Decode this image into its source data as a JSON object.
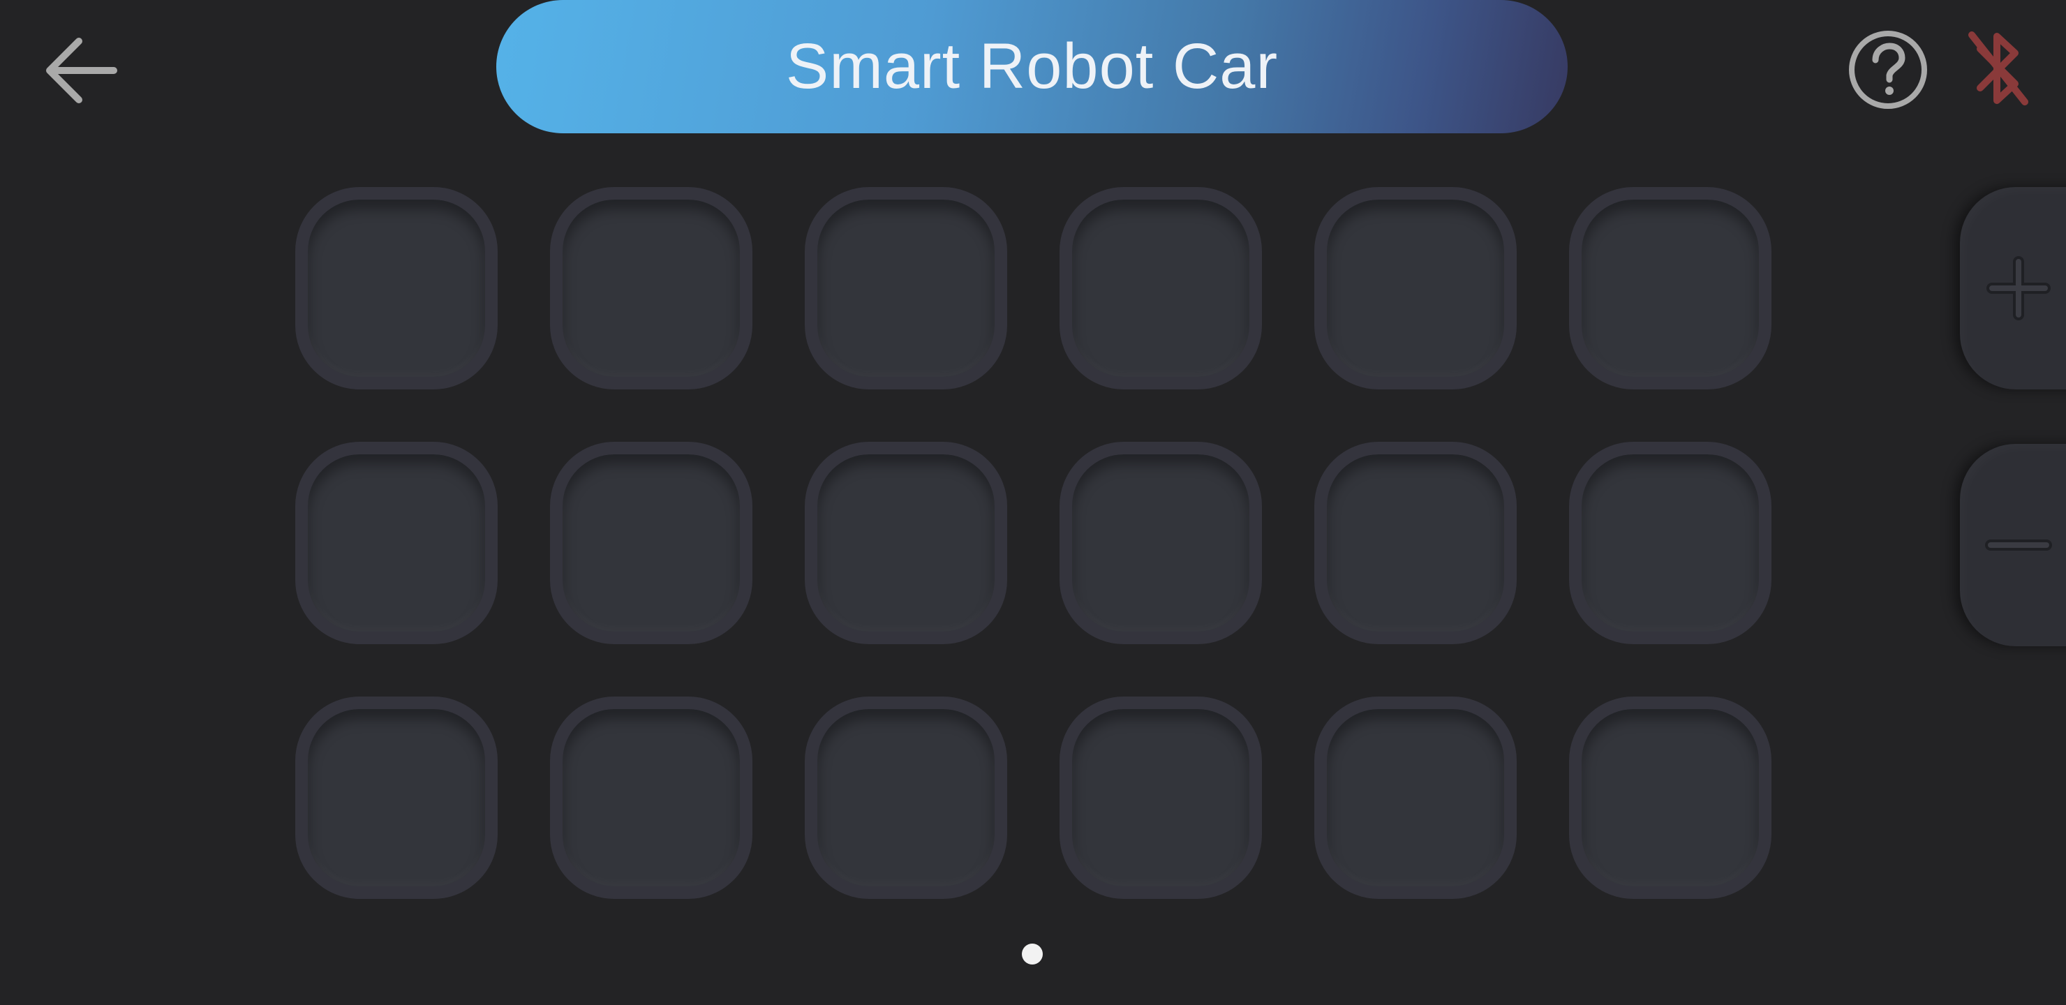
{
  "header": {
    "title": "Smart Robot Car",
    "icons": {
      "back": "back-arrow-icon",
      "help": "help-icon",
      "bluetooth": "bluetooth-disconnected-icon"
    }
  },
  "grid": {
    "rows": 3,
    "columns": 6,
    "slots": [
      {
        "row": 1,
        "col": 1
      },
      {
        "row": 1,
        "col": 2
      },
      {
        "row": 1,
        "col": 3
      },
      {
        "row": 1,
        "col": 4
      },
      {
        "row": 1,
        "col": 5
      },
      {
        "row": 1,
        "col": 6
      },
      {
        "row": 2,
        "col": 1
      },
      {
        "row": 2,
        "col": 2
      },
      {
        "row": 2,
        "col": 3
      },
      {
        "row": 2,
        "col": 4
      },
      {
        "row": 2,
        "col": 5
      },
      {
        "row": 2,
        "col": 6
      },
      {
        "row": 3,
        "col": 1
      },
      {
        "row": 3,
        "col": 2
      },
      {
        "row": 3,
        "col": 3
      },
      {
        "row": 3,
        "col": 4
      },
      {
        "row": 3,
        "col": 5
      },
      {
        "row": 3,
        "col": 6
      }
    ]
  },
  "side_controls": {
    "zoom_in_icon": "plus-icon",
    "zoom_out_icon": "minus-icon"
  },
  "pagination": {
    "current_page": 1,
    "total_pages": 1
  },
  "colors": {
    "background": "#232325",
    "title_gradient_start": "#55b2e8",
    "title_gradient_end": "#373a62",
    "slot_border": "#34343d",
    "slot_fill": "#33353b",
    "bluetooth_disconnected": "#8a3a3a",
    "icon_gray": "#a9a9a9"
  }
}
